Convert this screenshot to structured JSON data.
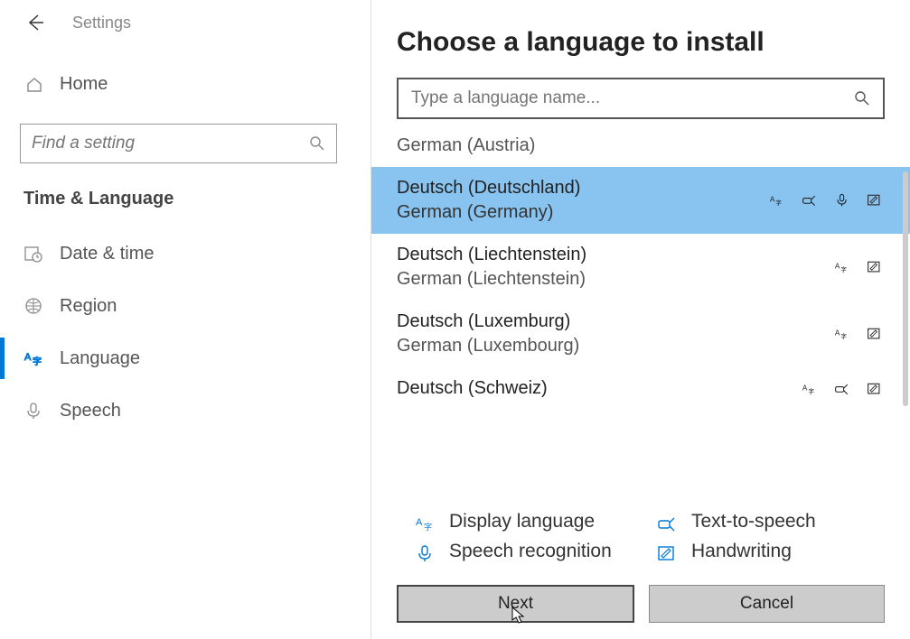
{
  "header": {
    "settings": "Settings"
  },
  "sidebar": {
    "home": "Home",
    "search_placeholder": "Find a setting",
    "section": "Time & Language",
    "items": [
      {
        "label": "Date & time"
      },
      {
        "label": "Region"
      },
      {
        "label": "Language"
      },
      {
        "label": "Speech"
      }
    ]
  },
  "modal": {
    "title": "Choose a language to install",
    "search_placeholder": "Type a language name...",
    "partial_above": "German (Austria)",
    "languages": [
      {
        "native": "Deutsch (Deutschland)",
        "english": "German (Germany)",
        "features": [
          "display",
          "tts",
          "speech",
          "handwriting"
        ],
        "selected": true
      },
      {
        "native": "Deutsch (Liechtenstein)",
        "english": "German (Liechtenstein)",
        "features": [
          "display",
          "handwriting"
        ],
        "selected": false
      },
      {
        "native": "Deutsch (Luxemburg)",
        "english": "German (Luxembourg)",
        "features": [
          "display",
          "handwriting"
        ],
        "selected": false
      },
      {
        "native": "Deutsch (Schweiz)",
        "english": "",
        "features": [
          "display",
          "tts",
          "handwriting"
        ],
        "selected": false
      }
    ],
    "legend": {
      "display": "Display language",
      "tts": "Text-to-speech",
      "speech": "Speech recognition",
      "handwriting": "Handwriting"
    },
    "next": "Next",
    "cancel": "Cancel"
  },
  "background": {
    "ar": "ar",
    "list": "list"
  }
}
